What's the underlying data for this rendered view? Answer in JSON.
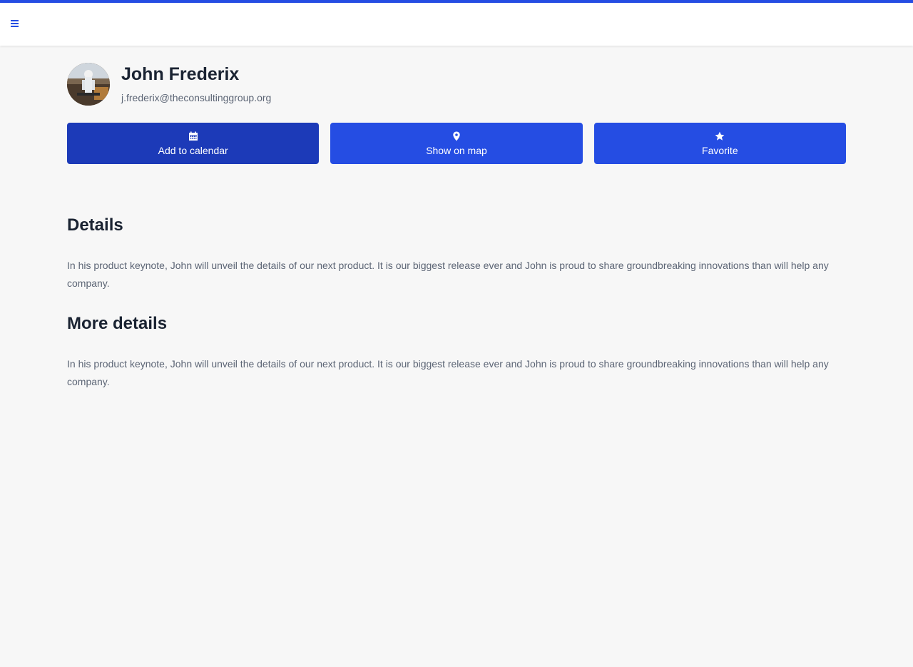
{
  "header": {
    "menu_icon": "hamburger-menu-icon",
    "accent_color": "#254de3"
  },
  "profile": {
    "name": "John Frederix",
    "email": "j.frederix@theconsultinggroup.org",
    "avatar_icon": "avatar-photo"
  },
  "actions": [
    {
      "label": "Add to calendar",
      "icon": "calendar-icon"
    },
    {
      "label": "Show on map",
      "icon": "map-pin-icon"
    },
    {
      "label": "Favorite",
      "icon": "star-icon"
    }
  ],
  "sections": [
    {
      "title": "Details",
      "body": "In his product keynote, John will unveil the details of our next product. It is our biggest release ever and John is proud to share groundbreaking innovations than will help any company."
    },
    {
      "title": "More details",
      "body": "In his product keynote, John will unveil the details of our next product. It is our biggest release ever and John is proud to share groundbreaking innovations than will help any company."
    }
  ],
  "colors": {
    "primary": "#254de3",
    "primary_active": "#1c3ab8",
    "background": "#f7f7f7",
    "heading": "#1a2332",
    "muted": "#5c6575"
  }
}
